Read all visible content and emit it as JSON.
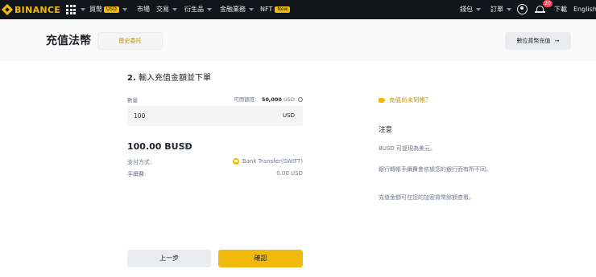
{
  "nav": {
    "logo": "BINANCE",
    "items": [
      {
        "label": "買幣",
        "tag": "USD"
      },
      {
        "label": "市場"
      },
      {
        "label": "交易"
      },
      {
        "label": "衍生品"
      },
      {
        "label": "金融業務"
      },
      {
        "label": "NFT",
        "tag": "New"
      }
    ],
    "wallet": "錢包",
    "orders": "訂單",
    "notification_count": "20",
    "download": "下載",
    "language": "English"
  },
  "header": {
    "title": "充值法幣",
    "history_button": "歷史委托",
    "crypto_deposit_button": "數位貨幣充值"
  },
  "form": {
    "step_number": "2.",
    "step_title": "輸入充值金額並下單",
    "quantity_label": "數量",
    "limit_label": "可用額度：",
    "limit_value": "50,000",
    "limit_unit": "USD",
    "amount_value": "100",
    "amount_unit": "USD",
    "total": "100.00 BUSD",
    "payment_label": "支付方式:",
    "payment_value": "Bank Transfer(SWIFT)",
    "fee_label": "手續費:",
    "fee_value": "0.00 USD",
    "back_button": "上一步",
    "confirm_button": "確認"
  },
  "side": {
    "not_arrived": "充值尚未到帳？",
    "notice_title": "注意",
    "notices": [
      "BUSD 可提現為美元。",
      "銀行轉帳手續費會依據您的銀行而有所不同。",
      "充值金額可在您的加密貨幣餘額查看。"
    ]
  },
  "colors": {
    "brand": "#f0b90b",
    "nav_bg": "#12161c",
    "accent_text": "#c99400"
  },
  "icons": [
    "binance-logo-icon",
    "apps-grid-icon",
    "user-icon",
    "bell-icon",
    "info-icon",
    "bank-icon",
    "hand-pointer-icon"
  ]
}
